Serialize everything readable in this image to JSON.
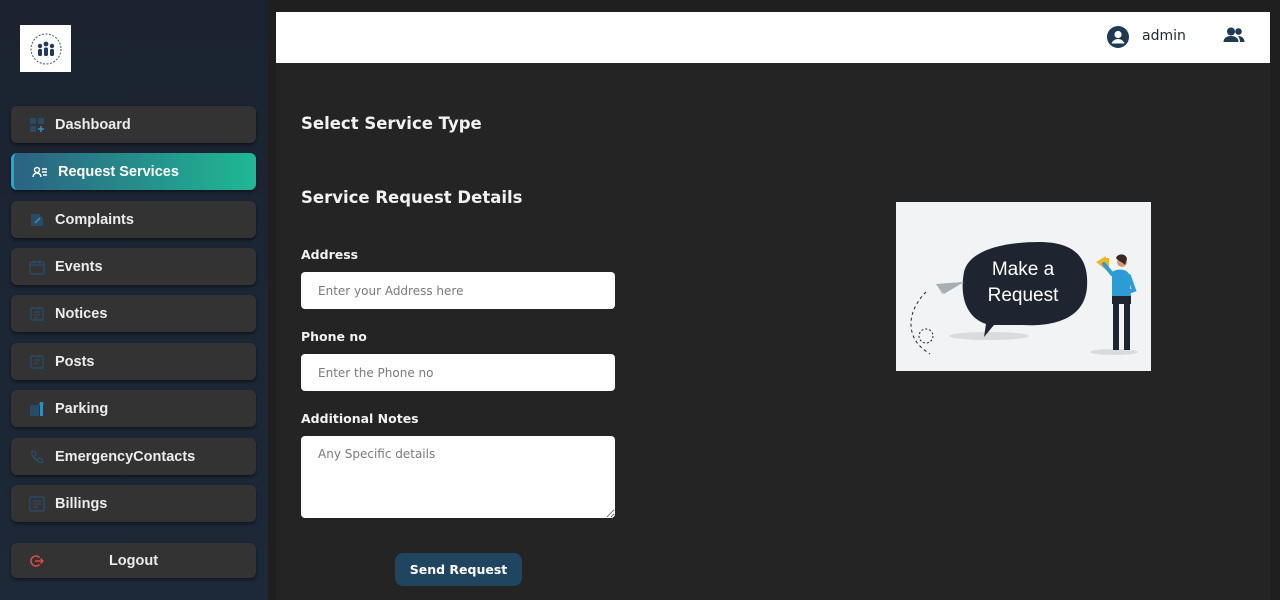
{
  "sidebar": {
    "items": [
      {
        "label": "Dashboard",
        "icon": "dashboard-icon"
      },
      {
        "label": "Request Services",
        "icon": "request-services-icon",
        "active": true
      },
      {
        "label": "Complaints",
        "icon": "complaints-icon"
      },
      {
        "label": "Events",
        "icon": "calendar-icon"
      },
      {
        "label": "Notices",
        "icon": "notices-icon"
      },
      {
        "label": "Posts",
        "icon": "posts-icon"
      },
      {
        "label": "Parking",
        "icon": "parking-icon"
      },
      {
        "label": "EmergencyContacts",
        "icon": "phone-icon"
      },
      {
        "label": "Billings",
        "icon": "billing-icon"
      }
    ],
    "logout_label": "Logout"
  },
  "header": {
    "user_name": "admin"
  },
  "main": {
    "select_title": "Select Service Type",
    "details_title": "Service Request Details",
    "address_label": "Address",
    "address_placeholder": "Enter your Address here",
    "phone_label": "Phone no",
    "phone_placeholder": "Enter the Phone no",
    "notes_label": "Additional Notes",
    "notes_placeholder": "Any Specific details",
    "send_label": "Send Request",
    "illustration_text_line1": "Make a",
    "illustration_text_line2": "Request"
  },
  "colors": {
    "accent_start": "#2c6282",
    "accent_end": "#1fb894",
    "button": "#1f4560",
    "logout_icon": "#e04848"
  }
}
